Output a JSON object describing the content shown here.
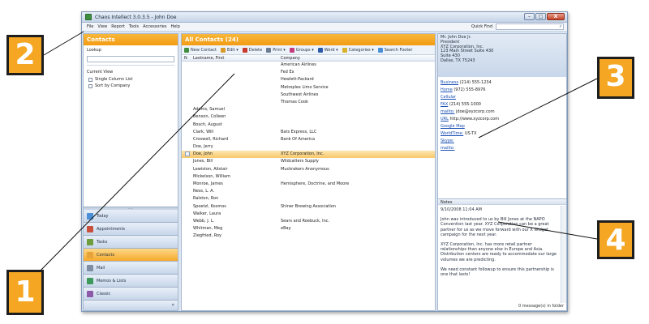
{
  "window": {
    "title": "Chaos Intellect 3.0.3.5 - John Doe",
    "controls": {
      "minimize": "–",
      "maximize": "□",
      "close": "X"
    }
  },
  "menu": {
    "items": [
      "File",
      "View",
      "Report",
      "Tools",
      "Accessories",
      "Help"
    ],
    "quick_find_label": "Quick Find"
  },
  "sidebar": {
    "header": "Contacts",
    "lookup_label": "Lookup",
    "current_view_label": "Current View",
    "options": [
      "Single Column List",
      "Sort by Company"
    ],
    "nav": [
      {
        "label": "Today",
        "icon": "today-icon",
        "color": "#4a8fd8"
      },
      {
        "label": "Appointments",
        "icon": "calendar-icon",
        "color": "#c94f3c"
      },
      {
        "label": "Tasks",
        "icon": "tasks-icon",
        "color": "#6f9c3c"
      },
      {
        "label": "Contacts",
        "icon": "contacts-icon",
        "color": "#e8a23a",
        "active": true
      },
      {
        "label": "Mail",
        "icon": "mail-icon",
        "color": "#7f8ea3"
      },
      {
        "label": "Memos & Lists",
        "icon": "memos-icon",
        "color": "#3e9a5a"
      },
      {
        "label": "Classic",
        "icon": "classic-icon",
        "color": "#8c5aa8"
      }
    ],
    "nav_bottom": "»"
  },
  "list": {
    "header": "All Contacts (24)",
    "toolbar": [
      {
        "label": "New Contact",
        "icon": "new-contact-icon",
        "color": "#3f8f3f"
      },
      {
        "label": "Edit ▾",
        "icon": "edit-icon",
        "color": "#d89a2a"
      },
      {
        "label": "Delete",
        "icon": "delete-icon",
        "color": "#c83a2a"
      },
      {
        "label": "Print ▾",
        "icon": "print-icon",
        "color": "#6b7c93"
      },
      {
        "label": "Groups ▾",
        "icon": "groups-icon",
        "color": "#c43c7e"
      },
      {
        "label": "Word ▾",
        "icon": "word-icon",
        "color": "#2a5aa8"
      },
      {
        "label": "Categories ▾",
        "icon": "categories-icon",
        "color": "#d8b22a"
      },
      {
        "label": "Search Footer",
        "icon": "search-footer-icon",
        "color": "#4a8fd8"
      }
    ],
    "columns": {
      "icon": "N",
      "name": "Lastname, First",
      "company": "Company"
    },
    "rows": [
      {
        "name": "",
        "company": "American Airlines"
      },
      {
        "name": "",
        "company": "Fed Ex"
      },
      {
        "name": "",
        "company": "Hewlett-Packard"
      },
      {
        "name": "",
        "company": "Metroplex Limo Service"
      },
      {
        "name": "",
        "company": "Southwest Airlines"
      },
      {
        "name": "",
        "company": "Thomas Cook"
      },
      {
        "name": "Adams, Samuel",
        "company": ""
      },
      {
        "name": "Benson, Colleen",
        "company": ""
      },
      {
        "name": "Bosch, August",
        "company": ""
      },
      {
        "name": "Clark, Will",
        "company": "Bats Express, LLC"
      },
      {
        "name": "Croswell, Richard",
        "company": "Bank Of America"
      },
      {
        "name": "Doe, Jerry",
        "company": ""
      },
      {
        "name": "Doe, John",
        "company": "XYZ Corporation, Inc.",
        "selected": true
      },
      {
        "name": "Jones, Bill",
        "company": "Wildcatters Supply"
      },
      {
        "name": "Lewiston, Alistair",
        "company": "Muckrakers Anonymous"
      },
      {
        "name": "Mickelson, William",
        "company": ""
      },
      {
        "name": "Monroe, James",
        "company": "Hemisphere, Doctrine, and Moore"
      },
      {
        "name": "Ness, L. A.",
        "company": ""
      },
      {
        "name": "Ralston, Ron",
        "company": ""
      },
      {
        "name": "Spoetzl, Kosmos",
        "company": "Shiner Brewing Association"
      },
      {
        "name": "Walker, Laura",
        "company": ""
      },
      {
        "name": "Webb, J. L.",
        "company": "Sears and Roebuck, Inc."
      },
      {
        "name": "Whitman, Meg",
        "company": "eBay"
      },
      {
        "name": "Ziegfried, Roy",
        "company": ""
      }
    ]
  },
  "detail": {
    "card": [
      "Mr. John Doe Jr.",
      "President",
      "XYZ Corporation, Inc.",
      "123 Main Street Suite 430",
      "Suite 430",
      "Dallas, TX 75243"
    ],
    "fields": [
      {
        "label": "Business",
        "value": "(214) 555-1234"
      },
      {
        "label": "Home",
        "value": "(972) 555-8976"
      },
      {
        "label": "Cellular",
        "value": ""
      },
      {
        "label": "FAX",
        "value": "(214) 555-1000"
      },
      {
        "label": "mailto:",
        "value": "jdoe@xyzcorp.com"
      },
      {
        "label": "URL",
        "value": "http://www.xyzcorp.com"
      },
      {
        "label": "Google Map",
        "value": ""
      },
      {
        "label": "WorldTime:",
        "value": "US-TX"
      },
      {
        "label": "Skype:",
        "value": ""
      },
      {
        "label": "mailto:",
        "value": ""
      }
    ],
    "notes_header": "Notes",
    "notes": [
      "9/10/2008 11:04 AM",
      "John was introduced to us by Bill Jones at the NAPO Convention last year. XYZ Corporation can be a great partner for us as we move forward with our X Widget campaign for the next year.",
      "XYZ Corporation, Inc. has more retail partner relationships than anyone else in Europe and Asia. Distribution centers are ready to accommodate our large volumes we are predicting.",
      "We need constant followup to ensure this partnership is one that lasts!"
    ],
    "message_count": "0 message(s) in folder"
  },
  "callouts": [
    "1",
    "2",
    "3",
    "4"
  ]
}
